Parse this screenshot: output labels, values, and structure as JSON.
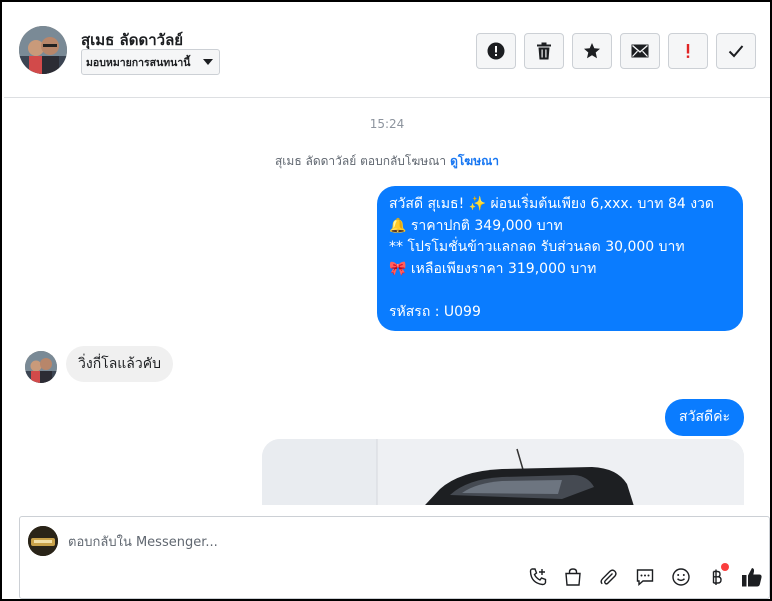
{
  "header": {
    "contact_name": "สุเมธ ลัดดาวัลย์",
    "assign_label": "มอบหมายการสนทนานี้",
    "actions": [
      {
        "name": "spam-button",
        "icon": "exclamation-circle-icon"
      },
      {
        "name": "delete-button",
        "icon": "trash-icon"
      },
      {
        "name": "star-button",
        "icon": "star-icon"
      },
      {
        "name": "mark-unread-button",
        "icon": "envelope-icon"
      },
      {
        "name": "follow-up-button",
        "icon": "exclamation-icon"
      },
      {
        "name": "mark-done-button",
        "icon": "check-icon"
      }
    ]
  },
  "conversation": {
    "timestamp": "15:24",
    "ad_note": "สุเมธ ลัดดาวัลย์ ตอบกลับโฆษณา",
    "ad_link": "ดูโฆษณา",
    "outgoing_1": {
      "line1": "สวัสดี สุเมธ! ✨  ผ่อนเริ่มต้นเพียง 6,xxx. บาท 84 งวด",
      "line2": "🔔 ราคาปกติ 349,000 บาท",
      "line3": "** โปรโมชั่นข้าวแลกลด รับส่วนลด 30,000 บาท",
      "line4": "🎀  เหลือเพียงราคา 319,000 บาท",
      "line5": " รหัสรถ : U099"
    },
    "incoming_1": "วิ่งกี่โลแล้วคับ",
    "outgoing_2": "สวัสดีค่ะ"
  },
  "composer": {
    "placeholder": "ตอบกลับใน Messenger...",
    "tools": [
      "call-add-icon",
      "shopping-bag-icon",
      "paperclip-icon",
      "saved-reply-icon",
      "emoji-icon",
      "baht-icon",
      "thumbs-up-icon"
    ]
  },
  "colors": {
    "outgoing_bubble": "#0a7cff",
    "incoming_bubble": "#f0f0f0",
    "link": "#1877f2",
    "notification_dot": "#fa3e3e"
  }
}
